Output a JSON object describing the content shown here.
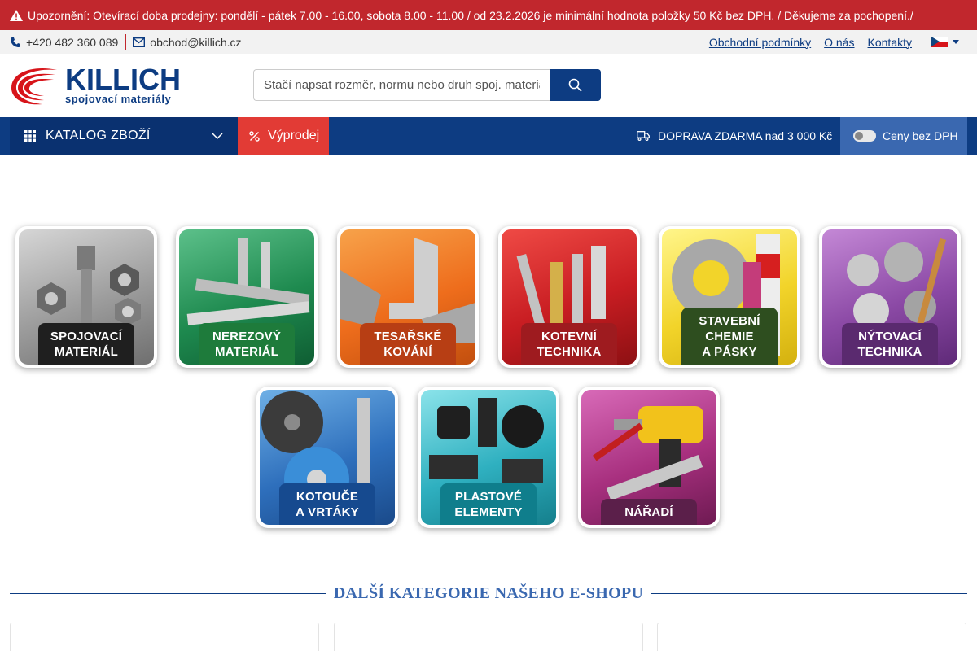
{
  "notice": {
    "text": "Upozornění: Otevírací doba prodejny: pondělí - pátek 7.00 - 16.00, sobota 8.00 - 11.00 / od 23.2.2026 je minimální hodnota položky 50 Kč bez DPH. / Děkujeme za pochopení./"
  },
  "contact": {
    "phone": "+420 482 360 089",
    "email": "obchod@killich.cz"
  },
  "top_links": {
    "terms": "Obchodní podmínky",
    "about": "O nás",
    "contacts": "Kontakty"
  },
  "logo": {
    "brand": "KILLICH",
    "sub": "spojovací materiály"
  },
  "search": {
    "placeholder": "Stačí napsat rozměr, normu nebo druh spoj. materiálu"
  },
  "nav": {
    "catalog": "KATALOG ZBOŽÍ",
    "sale": "Výprodej",
    "shipping": "DOPRAVA ZDARMA nad 3 000 Kč",
    "vat_toggle": "Ceny bez DPH"
  },
  "categories": [
    {
      "label": "SPOJOVACÍ\nMATERIÁL"
    },
    {
      "label": "NEREZOVÝ\nMATERIÁL"
    },
    {
      "label": "TESAŘSKÉ\nKOVÁNÍ"
    },
    {
      "label": "KOTEVNÍ\nTECHNIKA"
    },
    {
      "label": "STAVEBNÍ\nCHEMIE\nA PÁSKY"
    },
    {
      "label": "NÝTOVACÍ\nTECHNIKA"
    },
    {
      "label": "KOTOUČE\nA VRTÁKY"
    },
    {
      "label": "PLASTOVÉ\nELEMENTY"
    },
    {
      "label": "NÁŘADÍ"
    }
  ],
  "section_title": "DALŠÍ KATEGORIE NAŠEHO E-SHOPU",
  "colors": {
    "brand_blue": "#0d3c82",
    "notice_red": "#c1272d",
    "sale_red": "#e23b35",
    "vat_blue": "#3a68b0"
  }
}
